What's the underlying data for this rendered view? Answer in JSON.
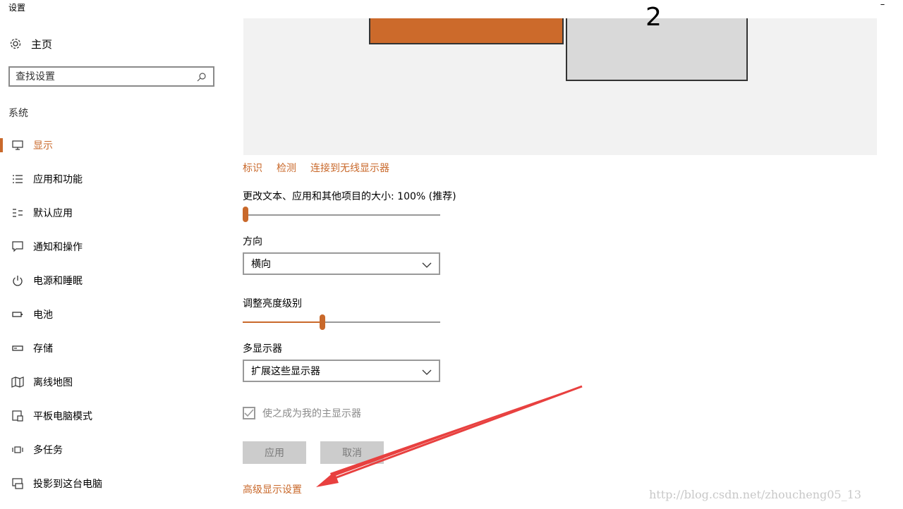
{
  "window": {
    "title": "设置",
    "minimize_glyph": "–"
  },
  "sidebar": {
    "home": {
      "icon": "gear-icon",
      "label": "主页"
    },
    "search": {
      "placeholder": "查找设置",
      "icon": "search-icon"
    },
    "section_label": "系统",
    "items": [
      {
        "icon": "monitor-icon",
        "label": "显示",
        "active": true
      },
      {
        "icon": "list-icon",
        "label": "应用和功能"
      },
      {
        "icon": "default-apps-icon",
        "label": "默认应用"
      },
      {
        "icon": "message-icon",
        "label": "通知和操作"
      },
      {
        "icon": "power-icon",
        "label": "电源和睡眠"
      },
      {
        "icon": "battery-icon",
        "label": "电池"
      },
      {
        "icon": "storage-icon",
        "label": "存储"
      },
      {
        "icon": "map-icon",
        "label": "离线地图"
      },
      {
        "icon": "tablet-mode-icon",
        "label": "平板电脑模式"
      },
      {
        "icon": "multitask-icon",
        "label": "多任务"
      },
      {
        "icon": "project-icon",
        "label": "投影到这台电脑"
      }
    ]
  },
  "main": {
    "monitor2_number": "2",
    "links": {
      "identify": "标识",
      "detect": "检测",
      "wireless": "连接到无线显示器"
    },
    "scale": {
      "label": "更改文本、应用和其他项目的大小: 100% (推荐)",
      "value_fraction": 0.0
    },
    "orientation": {
      "label": "方向",
      "value": "横向"
    },
    "brightness": {
      "label": "调整亮度级别",
      "value_fraction": 0.4
    },
    "multi_display": {
      "label": "多显示器",
      "value": "扩展这些显示器"
    },
    "main_display_checkbox": {
      "label": "使之成为我的主显示器",
      "checked": true
    },
    "buttons": {
      "apply": "应用",
      "cancel": "取消"
    },
    "advanced_link": "高级显示设置"
  },
  "watermark": "http://blog.csdn.net/zhoucheng05_13",
  "colors": {
    "accent": "#c9692b",
    "annotation_arrow": "#e8403f"
  }
}
